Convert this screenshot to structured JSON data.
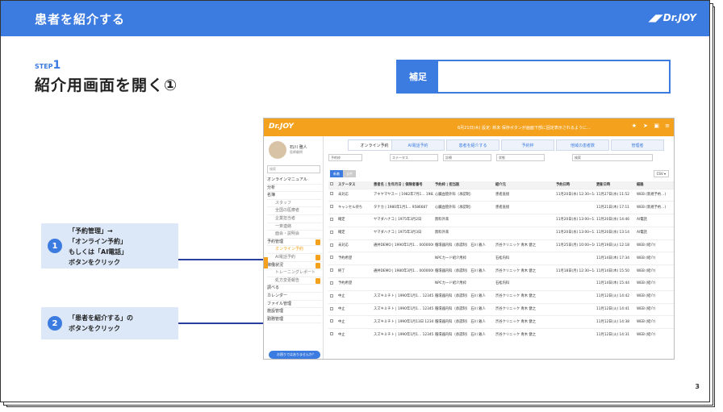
{
  "slide": {
    "header_title": "患者を紹介する",
    "header_logo": "Dr.JOY",
    "step_label": "STEP",
    "step_number": "1",
    "title": "紹介用画面を開く①",
    "note_label": "補足",
    "page_number": "3",
    "callouts": [
      {
        "num": "1",
        "lines": [
          "「予約管理」→",
          "「オンライン予約」",
          "もしくは「AI電話」",
          "ボタンをクリック"
        ]
      },
      {
        "num": "2",
        "lines": [
          "「患者を紹介する」の",
          "ボタンをクリック"
        ]
      }
    ]
  },
  "app": {
    "logo": "Dr.JOY",
    "banner": "6月21日(木) 設定: 新未  保存ボタンが画面下部に固定表示されるように…",
    "user_name": "石川 雅人",
    "user_role": "医師顧問",
    "search_placeholder": "検索",
    "menu": [
      {
        "label": "オンラインマニュアル",
        "type": "item"
      },
      {
        "label": "分析",
        "type": "item"
      },
      {
        "label": "名簿",
        "type": "item"
      },
      {
        "label": "スタッフ",
        "type": "sub"
      },
      {
        "label": "全国の医療者",
        "type": "sub"
      },
      {
        "label": "企業担当者",
        "type": "sub"
      },
      {
        "label": "一斉連絡",
        "type": "sub"
      },
      {
        "label": "面会・説明会",
        "type": "sub"
      },
      {
        "label": "予約管理",
        "type": "item",
        "badge": true
      },
      {
        "label": "オンライン予約",
        "type": "sub-on"
      },
      {
        "label": "AI電話予約",
        "type": "sub",
        "badge": true
      },
      {
        "label": "稼働状況",
        "type": "item",
        "badge": true
      },
      {
        "label": "トレーニングレポート",
        "type": "sub"
      },
      {
        "label": "処方変更報告",
        "type": "sub",
        "badge": true
      },
      {
        "label": "調べる",
        "type": "item"
      },
      {
        "label": "カレンダー",
        "type": "item"
      },
      {
        "label": "ファイル管理",
        "type": "item"
      },
      {
        "label": "施設管理",
        "type": "item"
      },
      {
        "label": "勤務管理",
        "type": "item"
      }
    ],
    "help": "お困りではありませんか？",
    "tabs": [
      "オンライン予約",
      "AI電話予約",
      "患者を紹介する",
      "予約枠",
      "他域の患者数",
      "管理者"
    ],
    "filters": [
      "予約枠",
      "ステータス",
      "診療",
      "状態",
      "検索"
    ],
    "status_tabs": [
      "新着",
      "全件"
    ],
    "csv": "CSV",
    "columns": [
      "ステータス",
      "患者名 | 生年月日 | 保険者番号",
      "予約枠 | 担当医",
      "紹介元",
      "予約日時",
      "更新日時",
      "経路"
    ],
    "rows": [
      [
        "未対応",
        "アキヤマヤスー | 1982年7月1… 19820723",
        "心臓血管外科（承認制）",
        "患者直接",
        "11月20日(水) 12:30~14:00 枠2件",
        "11月27日(水) 11:52",
        "WEB (新規予約…)"
      ],
      [
        "キャンセル待ち",
        "タナカ | 1980年1月1… 9586687",
        "心臓血管外科（承認制）",
        "患者直接",
        "",
        "11月21日(木) 17:11",
        "WEB (新規予約…)"
      ],
      [
        "確定",
        "ヤマダハナコ | 1975年3月2日",
        "無料外来",
        "",
        "11月20日(水) 13:00~13:30",
        "11月20日(水) 14:46",
        "AI電話"
      ],
      [
        "確定",
        "ヤマダハナコ | 1975年3月3日",
        "無料外来",
        "",
        "11月20日(水) 13:00~13:30",
        "11月20日(水) 13:14",
        "AI電話"
      ],
      [
        "未対応",
        "通井DEMO | 1990年1月1… 000000001",
        "循環器内科（承認制） 石川 雅人",
        "渋谷クリニック 青木 健之",
        "11月25日(月) 10:00~10:20 枠2件",
        "11月19日(火) 12:18",
        "WEB (紹介)"
      ],
      [
        "予約希望",
        "",
        "NPCカード紹介用枠",
        "石松内科",
        "",
        "11月14日(木) 17:34",
        "WEB (紹介)"
      ],
      [
        "終了",
        "通井DEMO | 1980年3月1… 000000001",
        "循環器内科（承認制） 石川 雅人",
        "渋谷クリニック 青木 健之",
        "11月18日(月) 12:30~14:00",
        "11月14日(木) 15:50",
        "WEB (紹介)"
      ],
      [
        "予約希望",
        "",
        "NPCカード紹介用枠",
        "石松内科",
        "",
        "11月14日(木) 15:44",
        "WEB (紹介)"
      ],
      [
        "中止",
        "スズキミチト | 1990年1月1… 12345678",
        "循環器内科（承認制） 石川 雅人",
        "渋谷クリニック 青木 健之",
        "",
        "11月12日(火) 14:42",
        "WEB (紹介)"
      ],
      [
        "中止",
        "スズキミチト | 1990年1月1… 12345678",
        "循環器内科（承認制） 石川 雅人",
        "渋谷クリニック 青木 健之",
        "",
        "11月12日(火) 14:41",
        "WEB (紹介)"
      ],
      [
        "中止",
        "スズキミチト | 1990年1月13日 12345678",
        "循環器内科（承認制） 石川 雅人",
        "渋谷クリニック 青木 健之",
        "",
        "11月12日(火) 14:38",
        "WEB (紹介)"
      ],
      [
        "中止",
        "スズキミチト | 1990年1月1… 12345678",
        "循環器内科（承認制） 石川 雅人",
        "渋谷クリニック 青木 健之",
        "",
        "11月12日(火) 14:31",
        "WEB (紹介)"
      ]
    ]
  },
  "colors": {
    "primary": "#3c7be0",
    "app_orange": "#f4a21d",
    "callout_bg": "#dce8f8",
    "connector": "#2b3f9e"
  }
}
